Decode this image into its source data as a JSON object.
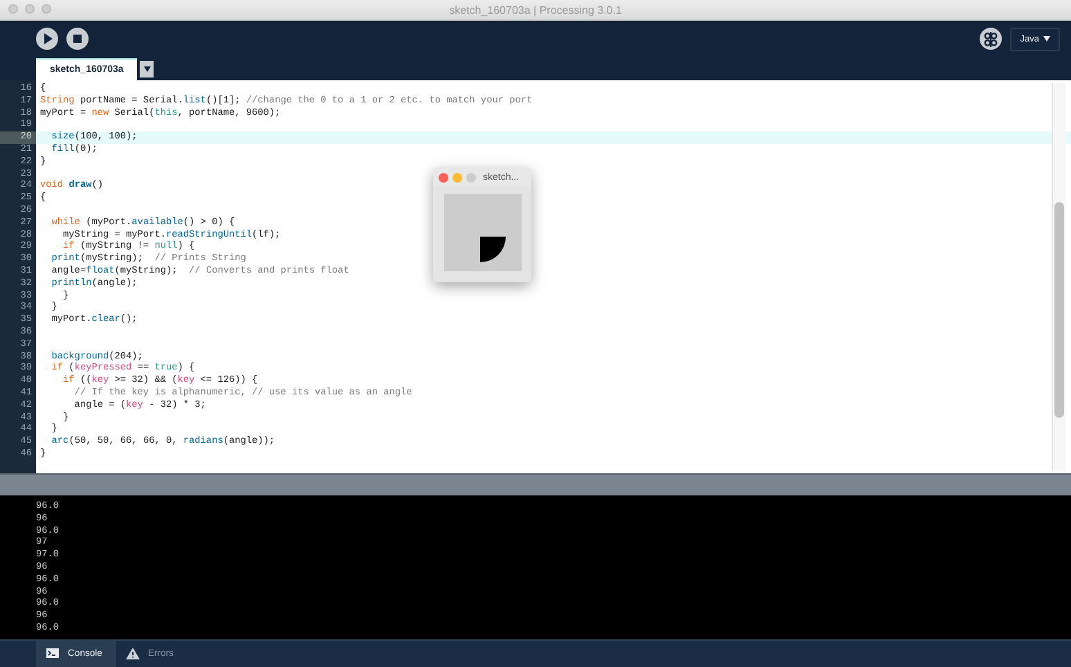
{
  "window": {
    "title": "sketch_160703a | Processing 3.0.1"
  },
  "toolbar": {
    "mode": "Java"
  },
  "tabs": [
    {
      "label": "sketch_160703a",
      "selected": true
    }
  ],
  "editor": {
    "lines": [
      {
        "number": "16",
        "current": false,
        "tokens": [
          {
            "kind": "plain",
            "text": "{"
          }
        ]
      },
      {
        "number": "17",
        "current": false,
        "tokens": [
          {
            "kind": "keyword",
            "text": "String"
          },
          {
            "kind": "plain",
            "text": " portName = Serial."
          },
          {
            "kind": "function",
            "text": "list"
          },
          {
            "kind": "plain",
            "text": "()[1]; "
          },
          {
            "kind": "comment",
            "text": "//change the 0 to a 1 or 2 etc. to match your port"
          }
        ]
      },
      {
        "number": "18",
        "current": false,
        "tokens": [
          {
            "kind": "plain",
            "text": "myPort = "
          },
          {
            "kind": "keyword",
            "text": "new"
          },
          {
            "kind": "plain",
            "text": " Serial("
          },
          {
            "kind": "literal",
            "text": "this"
          },
          {
            "kind": "plain",
            "text": ", portName, 9600);"
          }
        ]
      },
      {
        "number": "19",
        "current": false
      },
      {
        "number": "20",
        "current": true,
        "tokens": [
          {
            "kind": "function",
            "text": "  size"
          },
          {
            "kind": "plain",
            "text": "(100, 100);"
          }
        ]
      },
      {
        "number": "21",
        "current": false,
        "tokens": [
          {
            "kind": "function",
            "text": "  fill"
          },
          {
            "kind": "plain",
            "text": "(0);"
          }
        ]
      },
      {
        "number": "22",
        "current": false,
        "tokens": [
          {
            "kind": "plain",
            "text": "}"
          }
        ]
      },
      {
        "number": "23",
        "current": false
      },
      {
        "number": "24",
        "current": false,
        "tokens": [
          {
            "kind": "keyword",
            "text": "void "
          },
          {
            "kind": "definition",
            "text": "draw"
          },
          {
            "kind": "plain",
            "text": "()"
          }
        ]
      },
      {
        "number": "25",
        "current": false,
        "tokens": [
          {
            "kind": "plain",
            "text": "{"
          }
        ]
      },
      {
        "number": "26",
        "current": false
      },
      {
        "number": "27",
        "current": false,
        "tokens": [
          {
            "kind": "keyword",
            "text": "  while"
          },
          {
            "kind": "plain",
            "text": " (myPort."
          },
          {
            "kind": "function",
            "text": "available"
          },
          {
            "kind": "plain",
            "text": "() > 0) {"
          }
        ]
      },
      {
        "number": "28",
        "current": false,
        "tokens": [
          {
            "kind": "plain",
            "text": "    myString = myPort."
          },
          {
            "kind": "function",
            "text": "readStringUntil"
          },
          {
            "kind": "plain",
            "text": "(lf);"
          }
        ]
      },
      {
        "number": "29",
        "current": false,
        "tokens": [
          {
            "kind": "keyword",
            "text": "    if"
          },
          {
            "kind": "plain",
            "text": " (myString != "
          },
          {
            "kind": "literal",
            "text": "null"
          },
          {
            "kind": "plain",
            "text": ") {"
          }
        ]
      },
      {
        "number": "30",
        "current": false,
        "tokens": [
          {
            "kind": "function",
            "text": "  print"
          },
          {
            "kind": "plain",
            "text": "(myString);  "
          },
          {
            "kind": "comment",
            "text": "// Prints String"
          }
        ]
      },
      {
        "number": "31",
        "current": false,
        "tokens": [
          {
            "kind": "plain",
            "text": "  angle="
          },
          {
            "kind": "function",
            "text": "float"
          },
          {
            "kind": "plain",
            "text": "(myString);  "
          },
          {
            "kind": "comment",
            "text": "// Converts and prints float"
          }
        ]
      },
      {
        "number": "32",
        "current": false,
        "tokens": [
          {
            "kind": "function",
            "text": "  println"
          },
          {
            "kind": "plain",
            "text": "(angle);"
          }
        ]
      },
      {
        "number": "33",
        "current": false,
        "tokens": [
          {
            "kind": "plain",
            "text": "    }"
          }
        ]
      },
      {
        "number": "34",
        "current": false,
        "tokens": [
          {
            "kind": "plain",
            "text": "  }"
          }
        ]
      },
      {
        "number": "35",
        "current": false,
        "tokens": [
          {
            "kind": "plain",
            "text": "  myPort."
          },
          {
            "kind": "function",
            "text": "clear"
          },
          {
            "kind": "plain",
            "text": "();"
          }
        ]
      },
      {
        "number": "36",
        "current": false
      },
      {
        "number": "37",
        "current": false
      },
      {
        "number": "38",
        "current": false,
        "tokens": [
          {
            "kind": "function",
            "text": "  background"
          },
          {
            "kind": "plain",
            "text": "(204);"
          }
        ]
      },
      {
        "number": "39",
        "current": false,
        "tokens": [
          {
            "kind": "keyword",
            "text": "  if"
          },
          {
            "kind": "plain",
            "text": " ("
          },
          {
            "kind": "variable",
            "text": "keyPressed"
          },
          {
            "kind": "plain",
            "text": " == "
          },
          {
            "kind": "literal",
            "text": "true"
          },
          {
            "kind": "plain",
            "text": ") {"
          }
        ]
      },
      {
        "number": "40",
        "current": false,
        "tokens": [
          {
            "kind": "keyword",
            "text": "    if"
          },
          {
            "kind": "plain",
            "text": " (("
          },
          {
            "kind": "variable",
            "text": "key"
          },
          {
            "kind": "plain",
            "text": " >= 32) && ("
          },
          {
            "kind": "variable",
            "text": "key"
          },
          {
            "kind": "plain",
            "text": " <= 126)) {"
          }
        ]
      },
      {
        "number": "41",
        "current": false,
        "tokens": [
          {
            "kind": "comment",
            "text": "      // If the key is alphanumeric, // use its value as an angle"
          }
        ]
      },
      {
        "number": "42",
        "current": false,
        "tokens": [
          {
            "kind": "plain",
            "text": "      angle = ("
          },
          {
            "kind": "variable",
            "text": "key"
          },
          {
            "kind": "plain",
            "text": " - 32) * 3;"
          }
        ]
      },
      {
        "number": "43",
        "current": false,
        "tokens": [
          {
            "kind": "plain",
            "text": "    }"
          }
        ]
      },
      {
        "number": "44",
        "current": false,
        "tokens": [
          {
            "kind": "plain",
            "text": "  }"
          }
        ]
      },
      {
        "number": "45",
        "current": false,
        "tokens": [
          {
            "kind": "function",
            "text": "  arc"
          },
          {
            "kind": "plain",
            "text": "(50, 50, 66, 66, 0, "
          },
          {
            "kind": "function",
            "text": "radians"
          },
          {
            "kind": "plain",
            "text": "(angle));"
          }
        ]
      },
      {
        "number": "46",
        "current": false,
        "tokens": [
          {
            "kind": "plain",
            "text": "}"
          }
        ]
      }
    ]
  },
  "sketch_window": {
    "title": "sketch..."
  },
  "console": {
    "lines": [
      "96.0",
      "96",
      "96.0",
      "97",
      "97.0",
      "96",
      "96.0",
      "96",
      "96.0",
      "96",
      "96.0"
    ]
  },
  "footer_tabs": [
    {
      "label": "Console",
      "kind": "console",
      "selected": true
    },
    {
      "label": "Errors",
      "kind": "errors",
      "selected": false
    }
  ]
}
